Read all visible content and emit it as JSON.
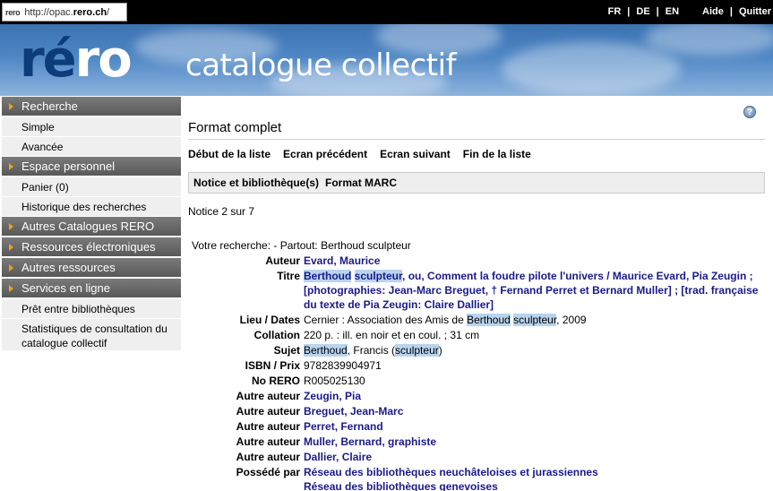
{
  "browser": {
    "favicon_text": "rero",
    "url_prefix": "http://opac.",
    "url_domain": "rero.ch",
    "url_suffix": "/"
  },
  "top_links": {
    "fr": "FR",
    "de": "DE",
    "en": "EN",
    "sep": "|",
    "help": "Aide",
    "quit": "Quitter"
  },
  "banner": {
    "logo_part1": "ré",
    "logo_part2": "ro",
    "title": "catalogue collectif"
  },
  "sidebar": {
    "recherche": "Recherche",
    "simple": "Simple",
    "avancee": "Avancée",
    "espace": "Espace personnel",
    "panier": "Panier (0)",
    "historique": "Historique des recherches",
    "autres_catalogues": "Autres Catalogues RERO",
    "ressources_elec": "Ressources électroniques",
    "autres_ressources": "Autres ressources",
    "services": "Services en ligne",
    "pret": "Prêt entre bibliothèques",
    "stats": "Statistiques de consultation du catalogue collectif"
  },
  "main": {
    "help_glyph": "?",
    "title": "Format complet",
    "nav": {
      "debut": "Début de la liste",
      "precedent": "Ecran précédent",
      "suivant": "Ecran suivant",
      "fin": "Fin de la liste"
    },
    "tabs": {
      "notice": "Notice et bibliothèque(s)",
      "marc": "Format MARC"
    },
    "notice_count": "Notice 2 sur 7"
  },
  "record": {
    "search_line": "Votre recherche: - Partout: Berthoud sculpteur",
    "labels": {
      "auteur": "Auteur",
      "titre": "Titre",
      "lieu": "Lieu / Dates",
      "collation": "Collation",
      "sujet": "Sujet",
      "isbn": "ISBN / Prix",
      "norero": "No RERO",
      "autre": "Autre auteur",
      "possede": "Possédé par"
    },
    "auteur": "Evard, Maurice",
    "titre_hl1": "Berthoud",
    "titre_sp1": " ",
    "titre_hl2": "sculpteur",
    "titre_rest": ", ou, Comment la foudre pilote l'univers / Maurice Evard, Pia Zeugin ; [photographies: Jean-Marc Breguet, † Fernand Perret et Bernard Muller] ; [trad. française du texte de Pia Zeugin: Claire Dallier]",
    "lieu_pre": "Cernier : Association des Amis de ",
    "lieu_hl1": "Berthoud",
    "lieu_sp": " ",
    "lieu_hl2": "sculpteur",
    "lieu_post": ", 2009",
    "collation": "220 p. : ill. en noir et en coul. ; 31 cm",
    "sujet_hl1": "Berthoud",
    "sujet_mid": ", Francis (",
    "sujet_hl2": "sculpteur",
    "sujet_post": ")",
    "isbn": "9782839904971",
    "norero": "R005025130",
    "autres_auteurs": [
      "Zeugin, Pia",
      "Breguet, Jean-Marc",
      "Perret, Fernand",
      "Muller, Bernard, graphiste",
      "Dallier, Claire"
    ],
    "possede": [
      "Réseau des bibliothèques neuchâteloises et jurassiennes",
      "Réseau des bibliothèques genevoises"
    ]
  }
}
